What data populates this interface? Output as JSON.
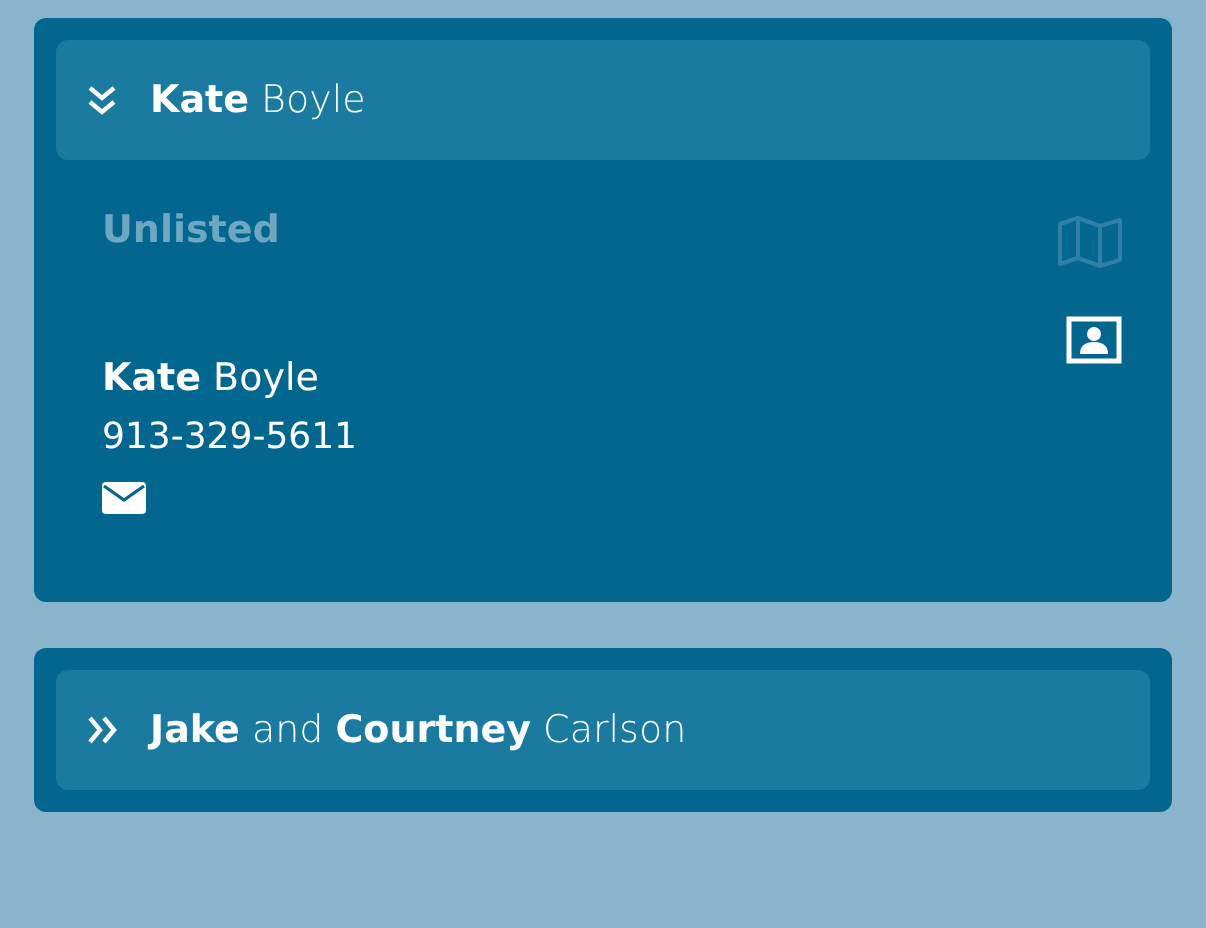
{
  "entries": [
    {
      "title": "**Kate** Boyle",
      "expanded": true,
      "status": "Unlisted",
      "map_enabled": false,
      "contact_name": "**Kate** Boyle",
      "phone": "913-329-5611"
    },
    {
      "title": "**Jake** and **Courtney** Carlson",
      "expanded": false
    }
  ]
}
